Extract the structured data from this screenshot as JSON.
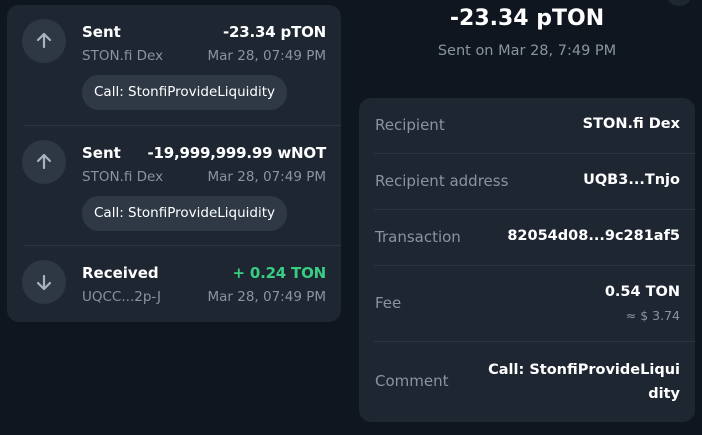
{
  "transactions": [
    {
      "direction": "sent",
      "title": "Sent",
      "amount": "-23.34 pTON",
      "counterparty": "STON.fi Dex",
      "date": "Mar 28, 07:49 PM",
      "call": "Call: StonfiProvideLiquidity",
      "icon": "arrow-up-icon"
    },
    {
      "direction": "sent",
      "title": "Sent",
      "amount": "-19,999,999.99 wNOT",
      "counterparty": "STON.fi Dex",
      "date": "Mar 28, 07:49 PM",
      "call": "Call: StonfiProvideLiquidity",
      "icon": "arrow-up-icon"
    },
    {
      "direction": "received",
      "title": "Received",
      "amount": "+ 0.24 TON",
      "counterparty": "UQCC...2p-J",
      "date": "Mar 28, 07:49 PM",
      "icon": "arrow-down-icon"
    }
  ],
  "detail": {
    "amount": "-23.34 pTON",
    "subtitle": "Sent on Mar 28, 7:49 PM",
    "recipient_label": "Recipient",
    "recipient_value": "STON.fi Dex",
    "address_label": "Recipient address",
    "address_value": "UQB3...Tnjo",
    "transaction_label": "Transaction",
    "transaction_value": "82054d08...9c281af5",
    "fee_label": "Fee",
    "fee_value": "0.54 TON",
    "fee_fiat": "≈ $ 3.74",
    "comment_label": "Comment",
    "comment_value": "Call: StonfiProvideLiquidity"
  },
  "colors": {
    "background": "#10161f",
    "card": "#1e2631",
    "chip": "#2f3946",
    "icon_circle": "#2e3844",
    "muted_text": "#8994a1",
    "positive": "#39cc83",
    "text": "#ffffff"
  }
}
